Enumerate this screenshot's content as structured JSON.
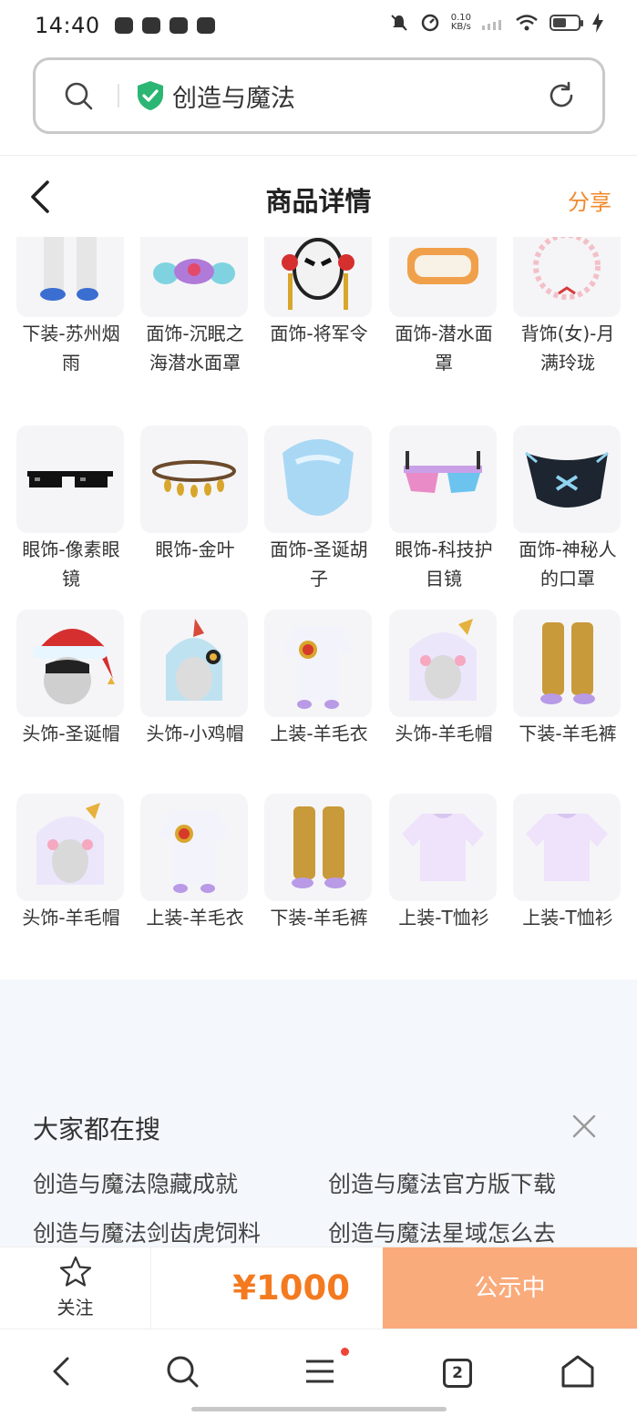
{
  "status_bar": {
    "time": "14:40",
    "net_speed_value": "0.10",
    "net_speed_unit": "KB/s"
  },
  "search": {
    "query": "创造与魔法"
  },
  "header": {
    "title": "商品详情",
    "share": "分享"
  },
  "items": [
    {
      "name": "下装-苏州烟雨"
    },
    {
      "name": "面饰-沉眠之海潜水面罩"
    },
    {
      "name": "面饰-将军令"
    },
    {
      "name": "面饰-潜水面罩"
    },
    {
      "name": "背饰(女)-月满玲珑"
    },
    {
      "name": "眼饰-像素眼镜"
    },
    {
      "name": "眼饰-金叶"
    },
    {
      "name": "面饰-圣诞胡子"
    },
    {
      "name": "眼饰-科技护目镜"
    },
    {
      "name": "面饰-神秘人的口罩"
    },
    {
      "name": "头饰-圣诞帽"
    },
    {
      "name": "头饰-小鸡帽"
    },
    {
      "name": "上装-羊毛衣"
    },
    {
      "name": "头饰-羊毛帽"
    },
    {
      "name": "下装-羊毛裤"
    },
    {
      "name": "头饰-羊毛帽"
    },
    {
      "name": "上装-羊毛衣"
    },
    {
      "name": "下装-羊毛裤"
    },
    {
      "name": "上装-T恤衫"
    },
    {
      "name": "上装-T恤衫"
    }
  ],
  "suggestions": {
    "title": "大家都在搜",
    "items": [
      "创造与魔法隐藏成就",
      "创造与魔法官方版下载",
      "创造与魔法剑齿虎饲料",
      "创造与魔法星域怎么去"
    ]
  },
  "action_bar": {
    "follow_label": "关注",
    "price": "¥1000",
    "status_button": "公示中"
  },
  "browser_nav": {
    "tab_count": "2"
  },
  "colors": {
    "accent": "#f47a20",
    "status_button_bg": "#f9ab7c",
    "share": "#f28a2c",
    "shield": "#2bb673"
  }
}
